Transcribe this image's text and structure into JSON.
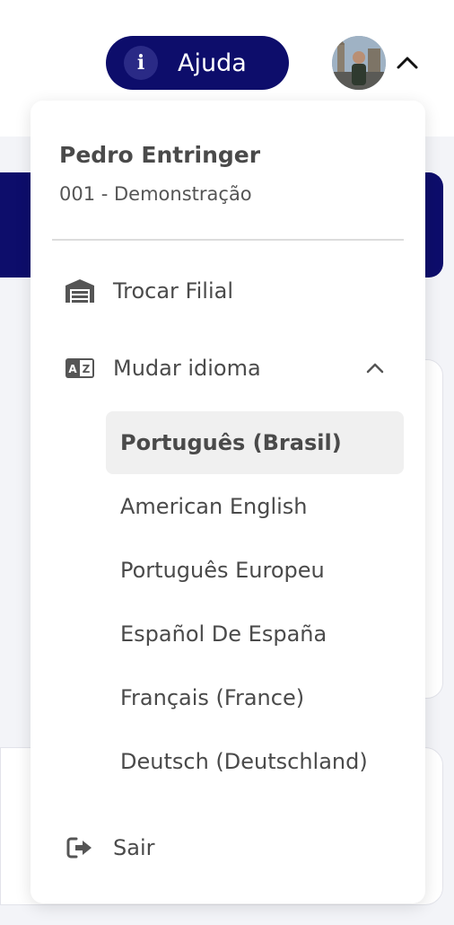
{
  "header": {
    "help_label": "Ajuda",
    "help_icon": "i"
  },
  "user": {
    "name": "Pedro Entringer",
    "company": "001 - Demonstração"
  },
  "menu": {
    "switch_branch_label": "Trocar Filial",
    "change_language_label": "Mudar idioma",
    "languages": [
      {
        "label": "Português (Brasil)",
        "selected": true
      },
      {
        "label": "American English",
        "selected": false
      },
      {
        "label": "Português Europeu",
        "selected": false
      },
      {
        "label": "Español De España",
        "selected": false
      },
      {
        "label": "Français (France)",
        "selected": false
      },
      {
        "label": "Deutsch (Deutschland)",
        "selected": false
      }
    ],
    "logout_label": "Sair"
  },
  "colors": {
    "primary": "#0d0d6b",
    "selected_bg": "#f0f0f0",
    "text": "#4a4a4a"
  }
}
